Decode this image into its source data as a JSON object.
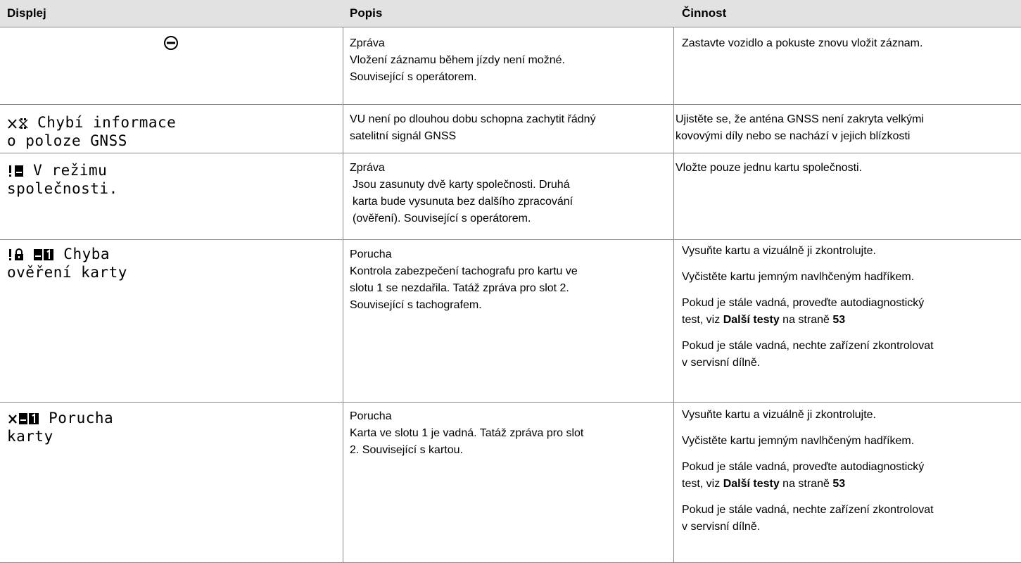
{
  "header": {
    "col_display": "Displej",
    "col_description": "Popis",
    "col_action": "Činnost"
  },
  "rows": [
    {
      "display_icons": [
        "no-entry-icon"
      ],
      "display_lines": [],
      "description": [
        "Zpráva",
        "Vložení záznamu během jízdy není možné.",
        "Související s operátorem."
      ],
      "actions": [
        [
          "Zastavte vozidlo a pokuste znovu vložit záznam."
        ]
      ]
    },
    {
      "display_icons": [
        "x-icon",
        "satellite-icon"
      ],
      "display_lines": [
        " Chybí informace",
        "o poloze GNSS"
      ],
      "description": [
        "VU není po dlouhou dobu schopna zachytit řádný",
        "satelitní signál GNSS"
      ],
      "actions": [
        [
          "Ujistěte se, že anténa GNSS není zakryta velkými",
          "kovovými díly nebo se nachází v jejich blízkosti"
        ]
      ]
    },
    {
      "display_icons": [
        "exclamation-icon",
        "card-icon"
      ],
      "display_lines": [
        " V režimu",
        "společnosti."
      ],
      "description": [
        "Zpráva",
        "Jsou zasunuty dvě karty společnosti. Druhá",
        "karta bude vysunuta bez dalšího zpracování",
        "(ověření). Související s operátorem."
      ],
      "actions": [
        [
          "Vložte pouze jednu kartu společnosti."
        ]
      ]
    },
    {
      "display_icons": [
        "exclamation-icon",
        "lock-icon",
        "card-icon",
        "slot-1-icon"
      ],
      "display_lines": [
        " Chyba",
        "ověření karty"
      ],
      "description": [
        "Porucha",
        "Kontrola zabezpečení tachografu pro kartu ve",
        "slotu 1 se nezdařila. Tatáž zpráva pro slot 2.",
        "Související s tachografem."
      ],
      "actions": [
        [
          "Vysuňte kartu a vizuálně ji zkontrolujte."
        ],
        [
          "Vyčistěte kartu jemným navlhčeným hadříkem."
        ],
        [
          "Pokud je stále vadná, proveďte autodiagnostický"
        ],
        [
          "Pokud je stále vadná, nechte zařízení zkontrolovat",
          "v servisní dílně."
        ]
      ],
      "link": {
        "prefix": "test, viz ",
        "link_text": "Další testy",
        "middle": " na straně ",
        "page": "53"
      }
    },
    {
      "display_icons": [
        "x-icon",
        "card-icon",
        "slot-1-icon"
      ],
      "display_lines": [
        " Porucha",
        "karty"
      ],
      "description": [
        "Porucha",
        "Karta ve slotu 1 je vadná. Tatáž zpráva pro slot",
        "2. Související s kartou."
      ],
      "actions": [
        [
          "Vysuňte kartu a vizuálně ji zkontrolujte."
        ],
        [
          "Vyčistěte kartu jemným navlhčeným hadříkem."
        ],
        [
          "Pokud je stále vadná, proveďte autodiagnostický"
        ],
        [
          "Pokud je stále vadná, nechte zařízení zkontrolovat",
          "v servisní dílně."
        ]
      ],
      "link": {
        "prefix": "test, viz ",
        "link_text": "Další testy",
        "middle": " na straně ",
        "page": "53"
      }
    }
  ]
}
